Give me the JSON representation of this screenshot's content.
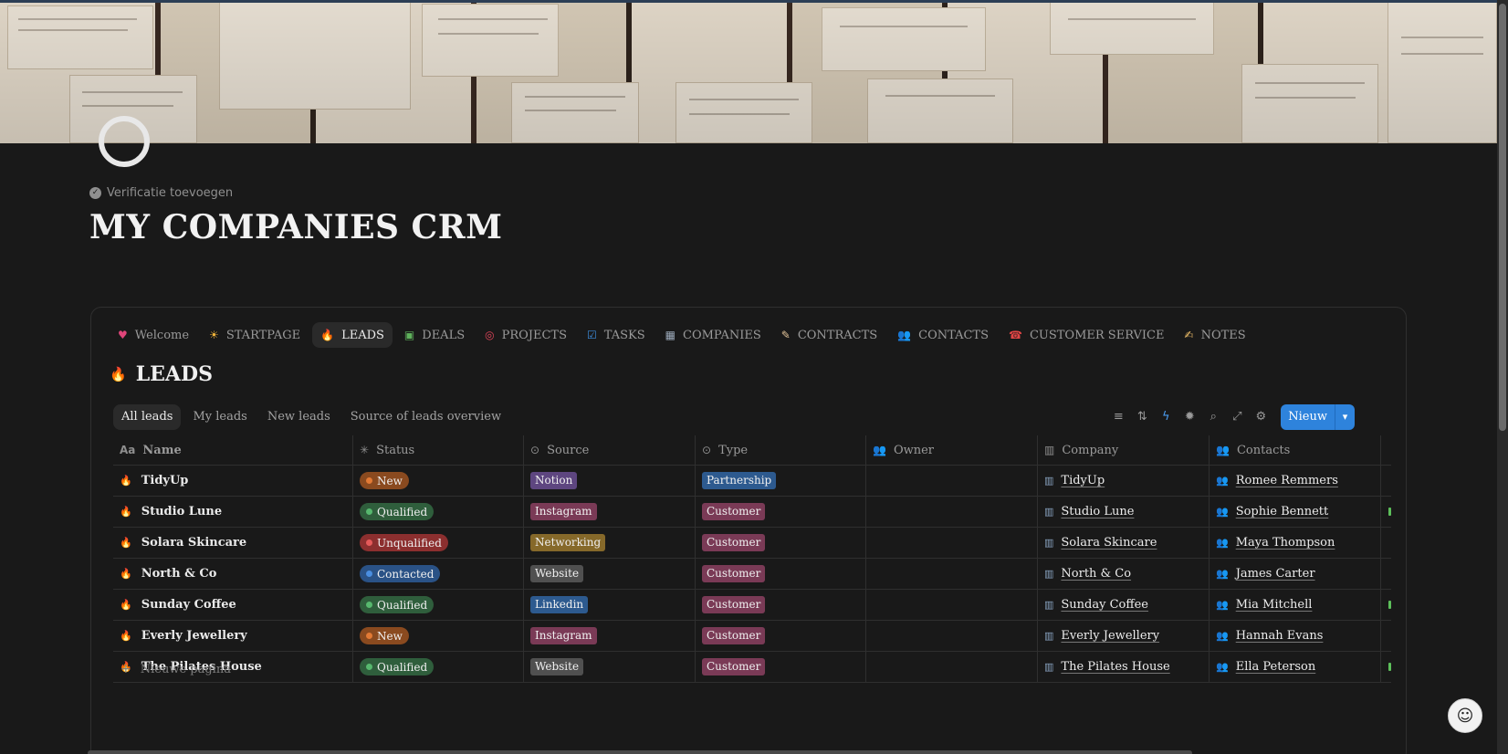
{
  "page": {
    "verification_label": "Verificatie toevoegen",
    "title": "MY COMPANIES CRM"
  },
  "tabs": [
    {
      "icon": "♥",
      "label": "Welcome",
      "icon_color": "#e0457a"
    },
    {
      "icon": "☀",
      "label": "STARTPAGE",
      "icon_color": "#f2b53a"
    },
    {
      "icon": "🔥",
      "label": "LEADS",
      "icon_color": "#e8742c",
      "active": true
    },
    {
      "icon": "▣",
      "label": "DEALS",
      "icon_color": "#5fb25c"
    },
    {
      "icon": "◎",
      "label": "PROJECTS",
      "icon_color": "#e0455a"
    },
    {
      "icon": "☑",
      "label": "TASKS",
      "icon_color": "#3d8fe0"
    },
    {
      "icon": "▦",
      "label": "COMPANIES",
      "icon_color": "#9aa8b8"
    },
    {
      "icon": "✎",
      "label": "CONTRACTS",
      "icon_color": "#e4c59a"
    },
    {
      "icon": "👥",
      "label": "CONTACTS",
      "icon_color": "#6f9fd8"
    },
    {
      "icon": "☎",
      "label": "CUSTOMER SERVICE",
      "icon_color": "#e04545"
    },
    {
      "icon": "✍",
      "label": "NOTES",
      "icon_color": "#f2c16a"
    }
  ],
  "section": {
    "icon": "🔥",
    "title": "LEADS"
  },
  "views": [
    {
      "label": "All leads",
      "active": true
    },
    {
      "label": "My leads"
    },
    {
      "label": "New leads"
    },
    {
      "label": "Source of leads overview"
    }
  ],
  "toolbar": {
    "icons": [
      "filter-icon",
      "sort-icon",
      "automation-icon",
      "ai-icon",
      "search-icon",
      "expand-icon",
      "settings-icon"
    ],
    "new_label": "Nieuw"
  },
  "columns": {
    "name": "Name",
    "status": "Status",
    "source": "Source",
    "type": "Type",
    "owner": "Owner",
    "company": "Company",
    "contacts": "Contacts"
  },
  "rows": [
    {
      "name": "TidyUp",
      "status": "New",
      "status_color": "#8a4a1f",
      "status_dot": "#e27a35",
      "source": "Notion",
      "source_color": "#5e4680",
      "type": "Partnership",
      "type_color": "#2d5a8f",
      "company": "TidyUp",
      "contact": "Romee Remmers",
      "mark": false
    },
    {
      "name": "Studio Lune",
      "status": "Qualified",
      "status_color": "#2f5e3c",
      "status_dot": "#57b86e",
      "source": "Instagram",
      "source_color": "#7a3a56",
      "type": "Customer",
      "type_color": "#7a3a56",
      "company": "Studio Lune",
      "contact": "Sophie Bennett",
      "mark": true
    },
    {
      "name": "Solara Skincare",
      "status": "Unqualified",
      "status_color": "#8c2f2f",
      "status_dot": "#e55a5a",
      "source": "Networking",
      "source_color": "#86692a",
      "type": "Customer",
      "type_color": "#7a3a56",
      "company": "Solara Skincare",
      "contact": "Maya Thompson",
      "mark": false
    },
    {
      "name": "North & Co",
      "status": "Contacted",
      "status_color": "#2a5286",
      "status_dot": "#4a8ee0",
      "source": "Website",
      "source_color": "#505050",
      "type": "Customer",
      "type_color": "#7a3a56",
      "company": "North & Co",
      "contact": "James Carter",
      "mark": false
    },
    {
      "name": "Sunday Coffee",
      "status": "Qualified",
      "status_color": "#2f5e3c",
      "status_dot": "#57b86e",
      "source": "Linkedin",
      "source_color": "#2d5a8f",
      "type": "Customer",
      "type_color": "#7a3a56",
      "company": "Sunday Coffee",
      "contact": "Mia Mitchell",
      "mark": true
    },
    {
      "name": "Everly Jewellery",
      "status": "New",
      "status_color": "#8a4a1f",
      "status_dot": "#e27a35",
      "source": "Instagram",
      "source_color": "#7a3a56",
      "type": "Customer",
      "type_color": "#7a3a56",
      "company": "Everly Jewellery",
      "contact": "Hannah Evans",
      "mark": false
    },
    {
      "name": "The Pilates House",
      "status": "Qualified",
      "status_color": "#2f5e3c",
      "status_dot": "#57b86e",
      "source": "Website",
      "source_color": "#505050",
      "type": "Customer",
      "type_color": "#7a3a56",
      "company": "The Pilates House",
      "contact": "Ella Peterson",
      "mark": true
    }
  ],
  "new_page_label": "Nieuwe pagina"
}
